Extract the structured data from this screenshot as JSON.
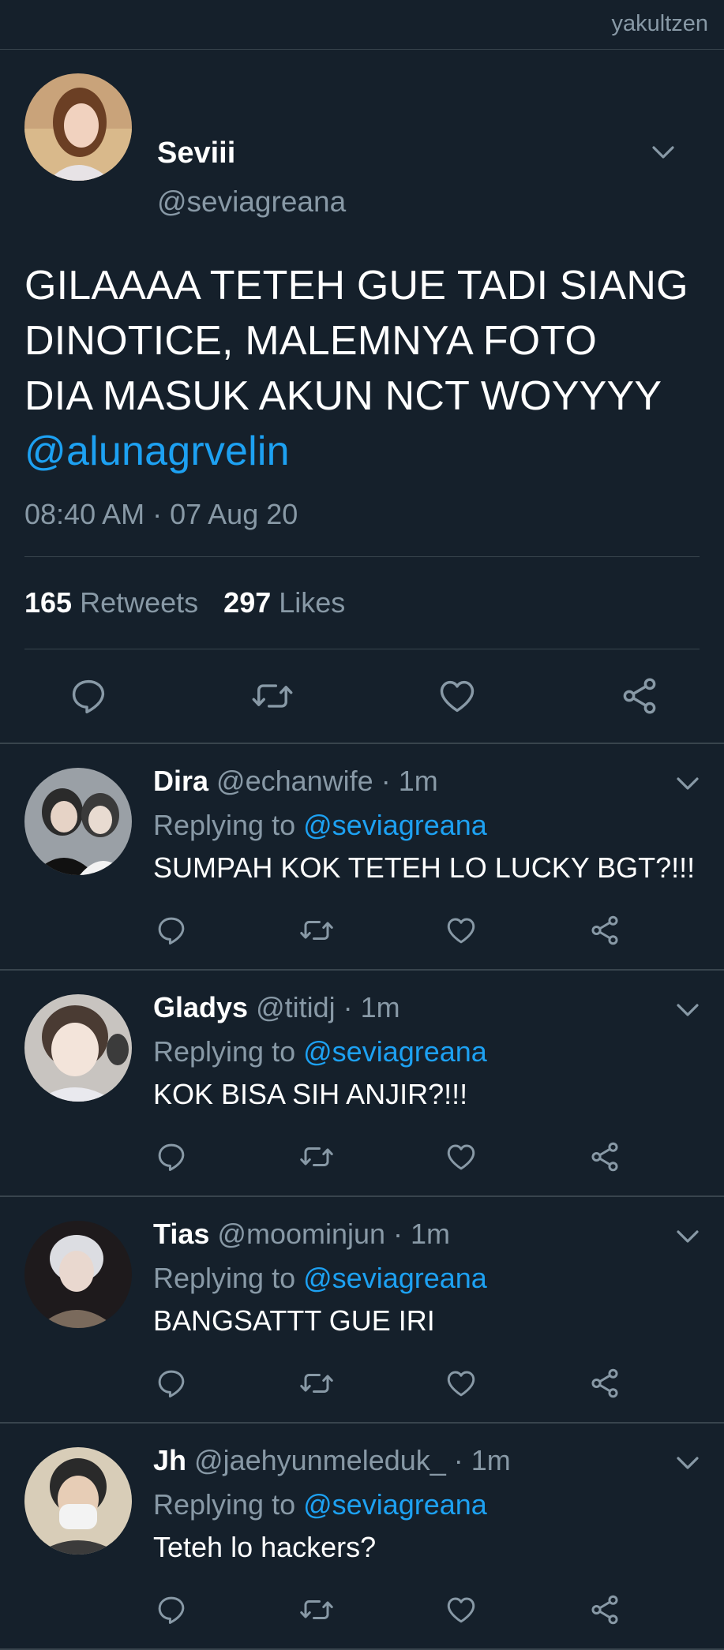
{
  "watermark": "yakultzen",
  "main_tweet": {
    "name": "Seviii",
    "handle": "@seviagreana",
    "text_lines": [
      "GILAAAA TETEH GUE TADI SIANG",
      "DINOTICE, MALEMNYA FOTO",
      "DIA MASUK AKUN NCT WOYYYY"
    ],
    "mention": "@alunagrvelin",
    "timestamp": "08:40 AM · 07 Aug 20",
    "retweets_count": "165",
    "retweets_label": "Retweets",
    "likes_count": "297",
    "likes_label": "Likes"
  },
  "replies": [
    {
      "name": "Dira",
      "handle": "@echanwife",
      "time": "· 1m",
      "replying_label": "Replying to",
      "replying_to": "@seviagreana",
      "text": "SUMPAH KOK TETEH LO LUCKY BGT?!!!"
    },
    {
      "name": "Gladys",
      "handle": "@titidj",
      "time": "· 1m",
      "replying_label": "Replying to",
      "replying_to": "@seviagreana",
      "text": "KOK BISA SIH ANJIR?!!!"
    },
    {
      "name": "Tias",
      "handle": "@moominjun",
      "time": "· 1m",
      "replying_label": "Replying to",
      "replying_to": "@seviagreana",
      "text": "BANGSATTT GUE IRI"
    },
    {
      "name": "Jh",
      "handle": "@jaehyunmeleduk_",
      "time": "· 1m",
      "replying_label": "Replying to",
      "replying_to": "@seviagreana",
      "text": "Teteh lo hackers?"
    }
  ],
  "icons": [
    "reply-icon",
    "retweet-icon",
    "like-icon",
    "share-icon",
    "chevron-down-icon"
  ],
  "colors": {
    "background": "#15202b",
    "accent": "#1da1f2",
    "muted": "#8899a6",
    "divider": "#38444d"
  }
}
